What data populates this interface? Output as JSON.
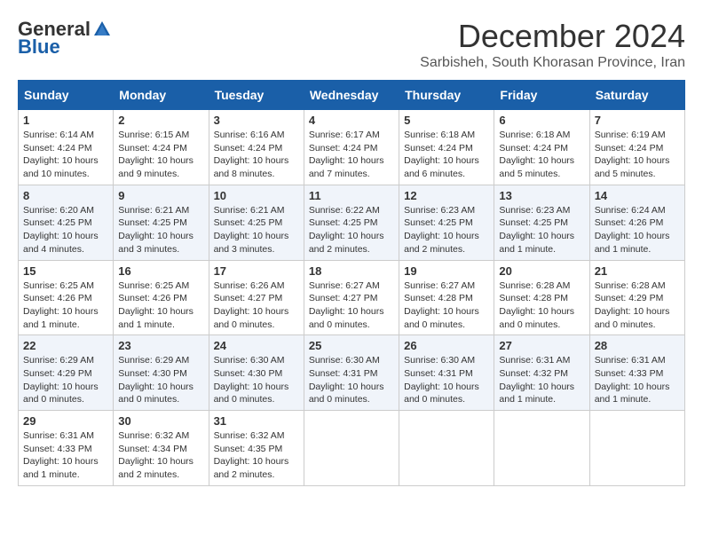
{
  "logo": {
    "general": "General",
    "blue": "Blue"
  },
  "title": "December 2024",
  "subtitle": "Sarbisheh, South Khorasan Province, Iran",
  "weekdays": [
    "Sunday",
    "Monday",
    "Tuesday",
    "Wednesday",
    "Thursday",
    "Friday",
    "Saturday"
  ],
  "weeks": [
    [
      {
        "day": "1",
        "sunrise": "6:14 AM",
        "sunset": "4:24 PM",
        "daylight": "10 hours and 10 minutes."
      },
      {
        "day": "2",
        "sunrise": "6:15 AM",
        "sunset": "4:24 PM",
        "daylight": "10 hours and 9 minutes."
      },
      {
        "day": "3",
        "sunrise": "6:16 AM",
        "sunset": "4:24 PM",
        "daylight": "10 hours and 8 minutes."
      },
      {
        "day": "4",
        "sunrise": "6:17 AM",
        "sunset": "4:24 PM",
        "daylight": "10 hours and 7 minutes."
      },
      {
        "day": "5",
        "sunrise": "6:18 AM",
        "sunset": "4:24 PM",
        "daylight": "10 hours and 6 minutes."
      },
      {
        "day": "6",
        "sunrise": "6:18 AM",
        "sunset": "4:24 PM",
        "daylight": "10 hours and 5 minutes."
      },
      {
        "day": "7",
        "sunrise": "6:19 AM",
        "sunset": "4:24 PM",
        "daylight": "10 hours and 5 minutes."
      }
    ],
    [
      {
        "day": "8",
        "sunrise": "6:20 AM",
        "sunset": "4:25 PM",
        "daylight": "10 hours and 4 minutes."
      },
      {
        "day": "9",
        "sunrise": "6:21 AM",
        "sunset": "4:25 PM",
        "daylight": "10 hours and 3 minutes."
      },
      {
        "day": "10",
        "sunrise": "6:21 AM",
        "sunset": "4:25 PM",
        "daylight": "10 hours and 3 minutes."
      },
      {
        "day": "11",
        "sunrise": "6:22 AM",
        "sunset": "4:25 PM",
        "daylight": "10 hours and 2 minutes."
      },
      {
        "day": "12",
        "sunrise": "6:23 AM",
        "sunset": "4:25 PM",
        "daylight": "10 hours and 2 minutes."
      },
      {
        "day": "13",
        "sunrise": "6:23 AM",
        "sunset": "4:25 PM",
        "daylight": "10 hours and 1 minute."
      },
      {
        "day": "14",
        "sunrise": "6:24 AM",
        "sunset": "4:26 PM",
        "daylight": "10 hours and 1 minute."
      }
    ],
    [
      {
        "day": "15",
        "sunrise": "6:25 AM",
        "sunset": "4:26 PM",
        "daylight": "10 hours and 1 minute."
      },
      {
        "day": "16",
        "sunrise": "6:25 AM",
        "sunset": "4:26 PM",
        "daylight": "10 hours and 1 minute."
      },
      {
        "day": "17",
        "sunrise": "6:26 AM",
        "sunset": "4:27 PM",
        "daylight": "10 hours and 0 minutes."
      },
      {
        "day": "18",
        "sunrise": "6:27 AM",
        "sunset": "4:27 PM",
        "daylight": "10 hours and 0 minutes."
      },
      {
        "day": "19",
        "sunrise": "6:27 AM",
        "sunset": "4:28 PM",
        "daylight": "10 hours and 0 minutes."
      },
      {
        "day": "20",
        "sunrise": "6:28 AM",
        "sunset": "4:28 PM",
        "daylight": "10 hours and 0 minutes."
      },
      {
        "day": "21",
        "sunrise": "6:28 AM",
        "sunset": "4:29 PM",
        "daylight": "10 hours and 0 minutes."
      }
    ],
    [
      {
        "day": "22",
        "sunrise": "6:29 AM",
        "sunset": "4:29 PM",
        "daylight": "10 hours and 0 minutes."
      },
      {
        "day": "23",
        "sunrise": "6:29 AM",
        "sunset": "4:30 PM",
        "daylight": "10 hours and 0 minutes."
      },
      {
        "day": "24",
        "sunrise": "6:30 AM",
        "sunset": "4:30 PM",
        "daylight": "10 hours and 0 minutes."
      },
      {
        "day": "25",
        "sunrise": "6:30 AM",
        "sunset": "4:31 PM",
        "daylight": "10 hours and 0 minutes."
      },
      {
        "day": "26",
        "sunrise": "6:30 AM",
        "sunset": "4:31 PM",
        "daylight": "10 hours and 0 minutes."
      },
      {
        "day": "27",
        "sunrise": "6:31 AM",
        "sunset": "4:32 PM",
        "daylight": "10 hours and 1 minute."
      },
      {
        "day": "28",
        "sunrise": "6:31 AM",
        "sunset": "4:33 PM",
        "daylight": "10 hours and 1 minute."
      }
    ],
    [
      {
        "day": "29",
        "sunrise": "6:31 AM",
        "sunset": "4:33 PM",
        "daylight": "10 hours and 1 minute."
      },
      {
        "day": "30",
        "sunrise": "6:32 AM",
        "sunset": "4:34 PM",
        "daylight": "10 hours and 2 minutes."
      },
      {
        "day": "31",
        "sunrise": "6:32 AM",
        "sunset": "4:35 PM",
        "daylight": "10 hours and 2 minutes."
      },
      null,
      null,
      null,
      null
    ]
  ]
}
